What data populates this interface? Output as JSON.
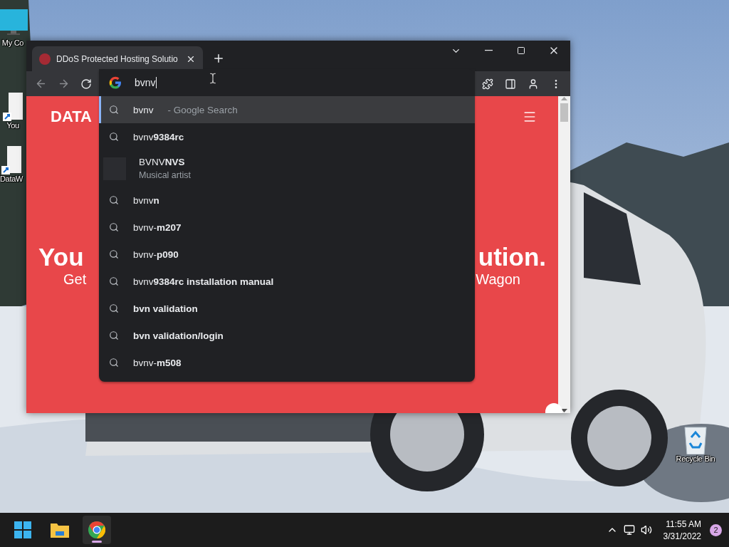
{
  "desktop_icons": [
    {
      "label": "My Co",
      "kind": "computer"
    },
    {
      "label": "You",
      "kind": "shortcut"
    },
    {
      "label": "DataW",
      "kind": "shortcut"
    }
  ],
  "recycle_bin": {
    "label": "Recycle Bin"
  },
  "browser": {
    "tabs": [
      {
        "title": "DDoS Protected Hosting Solutio",
        "selected": true
      }
    ],
    "omnibox": {
      "value": "bvnv"
    },
    "suggestions": [
      {
        "kind": "search",
        "text": "bvnv",
        "hint": "- Google Search",
        "selected": true
      },
      {
        "kind": "search",
        "text": "bvnv**9384rc**",
        "selected": false
      },
      {
        "kind": "entity",
        "text": "BVNV**NVS**",
        "subtitle": "Musical artist",
        "selected": false
      },
      {
        "kind": "search",
        "text": "bvnv**n**",
        "selected": false
      },
      {
        "kind": "search",
        "text": "bvnv-**m207**",
        "selected": false
      },
      {
        "kind": "search",
        "text": "bvnv-**p090**",
        "selected": false
      },
      {
        "kind": "search",
        "text": "bvnv**9384rc installation manual**",
        "selected": false
      },
      {
        "kind": "search",
        "text": "**bvn validation**",
        "selected": false
      },
      {
        "kind": "search",
        "text": "**bvn validation/login**",
        "selected": false
      },
      {
        "kind": "search",
        "text": "bvnv-**m508**",
        "selected": false
      }
    ],
    "page": {
      "logo": "DATA",
      "headline_left": "You",
      "headline_right": "ution.",
      "subtitle_left": "Get",
      "subtitle_right": "Wagon"
    }
  },
  "taskbar": {
    "apps": [
      {
        "kind": "start",
        "selected": false
      },
      {
        "kind": "files",
        "selected": false
      },
      {
        "kind": "chrome",
        "selected": true
      }
    ],
    "time": "11:55 AM",
    "date": "3/31/2022",
    "notifications": "2"
  }
}
